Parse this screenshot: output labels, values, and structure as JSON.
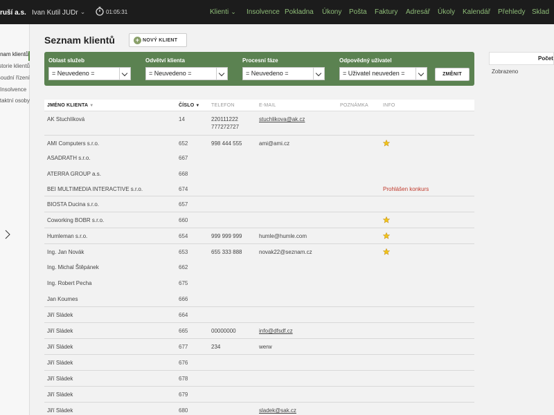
{
  "header": {
    "firm": "ruší a.s.",
    "user": "Ivan Kutil JUDr",
    "timer": "01:05:31",
    "nav": [
      {
        "label": "Klienti",
        "has_dropdown": true
      },
      {
        "label": "Insolvence"
      },
      {
        "label": "Pokladna"
      },
      {
        "label": "Úkony"
      },
      {
        "label": "Pošta"
      },
      {
        "label": "Faktury"
      },
      {
        "label": "Adresář"
      },
      {
        "label": "Úkoly"
      },
      {
        "label": "Kalendář"
      },
      {
        "label": "Přehledy"
      },
      {
        "label": "Sklad"
      }
    ]
  },
  "sidebar": {
    "items": [
      {
        "label": "Seznam klientů",
        "active": true
      },
      {
        "label": "Historie klientů"
      },
      {
        "label": "Soudní řízení"
      },
      {
        "label": "Insolvence"
      },
      {
        "label": "Kontaktní osoby"
      }
    ]
  },
  "main": {
    "title": "Seznam klientů",
    "new_button": "NOVÝ KLIENT",
    "filter": {
      "fields": [
        {
          "label": "Oblast služeb",
          "value": "= Neuvedeno ="
        },
        {
          "label": "Odvětví klienta",
          "value": "= Neuvedeno ="
        },
        {
          "label": "Procesní fáze",
          "value": "= Neuvedeno ="
        },
        {
          "label": "Odpovědný uživatel",
          "value": "= Uživatel neuveden ="
        }
      ],
      "button": "ZMĚNIT"
    },
    "table": {
      "columns": [
        "JMÉNO KLIENTA",
        "ČÍSLO",
        "TELEFON",
        "E-MAIL",
        "POZNÁMKA",
        "INFO"
      ],
      "rows": [
        {
          "name": "AK Stuchlíková",
          "number": "14",
          "phone": "220111222",
          "phone2": "777272727",
          "email": "stuchlikova@ak.cz",
          "info": "",
          "star": false
        },
        {
          "name": "AMI Computers s.r.o.",
          "number": "652",
          "phone": "998 444 555",
          "email": "ami@ami.cz",
          "info": "",
          "star": true
        },
        {
          "name": "ASADRATH s.r.o.",
          "number": "667",
          "phone": "",
          "email": "",
          "info": "",
          "star": false
        },
        {
          "name": "ATERRA GROUP a.s.",
          "number": "668",
          "phone": "",
          "email": "",
          "info": "",
          "star": false
        },
        {
          "name": "BEI MULTIMEDIA INTERACTIVE s.r.o.",
          "number": "674",
          "phone": "",
          "email": "",
          "info": "Prohlášen konkurs",
          "star": false
        },
        {
          "name": "BIOSTA Ducina s.r.o.",
          "number": "657",
          "phone": "",
          "email": "",
          "info": "",
          "star": false
        },
        {
          "name": "Coworking BOBR s.r.o.",
          "number": "660",
          "phone": "",
          "email": "",
          "info": "",
          "star": true
        },
        {
          "name": "Humleman s.r.o.",
          "number": "654",
          "phone": "999 999 999",
          "email": "humle@humle.com",
          "info": "",
          "star": true
        },
        {
          "name": "Ing. Jan Novák",
          "number": "653",
          "phone": "655 333 888",
          "email": "novak22@seznam.cz",
          "info": "",
          "star": true
        },
        {
          "name": "Ing. Michal Štěpánek",
          "number": "662",
          "phone": "",
          "email": "",
          "info": "",
          "star": false
        },
        {
          "name": "Ing. Robert Pecha",
          "number": "675",
          "phone": "",
          "email": "",
          "info": "",
          "star": false
        },
        {
          "name": "Jan Koumes",
          "number": "666",
          "phone": "",
          "email": "",
          "info": "",
          "star": false
        },
        {
          "name": "Jiří Sládek",
          "number": "664",
          "phone": "",
          "email": "",
          "info": "",
          "star": false
        },
        {
          "name": "Jiří Sládek",
          "number": "665",
          "phone": "00000000",
          "email": "info@dfsdf.cz",
          "info": "",
          "star": false
        },
        {
          "name": "Jiří Sládek",
          "number": "677",
          "phone": "234",
          "email": "werw",
          "info": "",
          "star": false
        },
        {
          "name": "Jiří Sládek",
          "number": "676",
          "phone": "",
          "email": "",
          "info": "",
          "star": false
        },
        {
          "name": "Jiří Sládek",
          "number": "678",
          "phone": "",
          "email": "",
          "info": "",
          "star": false
        },
        {
          "name": "Jiří Sládek",
          "number": "679",
          "phone": "",
          "email": "",
          "info": "",
          "star": false
        },
        {
          "name": "Jiří Sládek",
          "number": "680",
          "phone": "",
          "email": "sladek@sak.cz",
          "info": "",
          "star": false
        }
      ]
    }
  },
  "right_panel": {
    "header": "Počet",
    "text": "Zobrazeno"
  }
}
